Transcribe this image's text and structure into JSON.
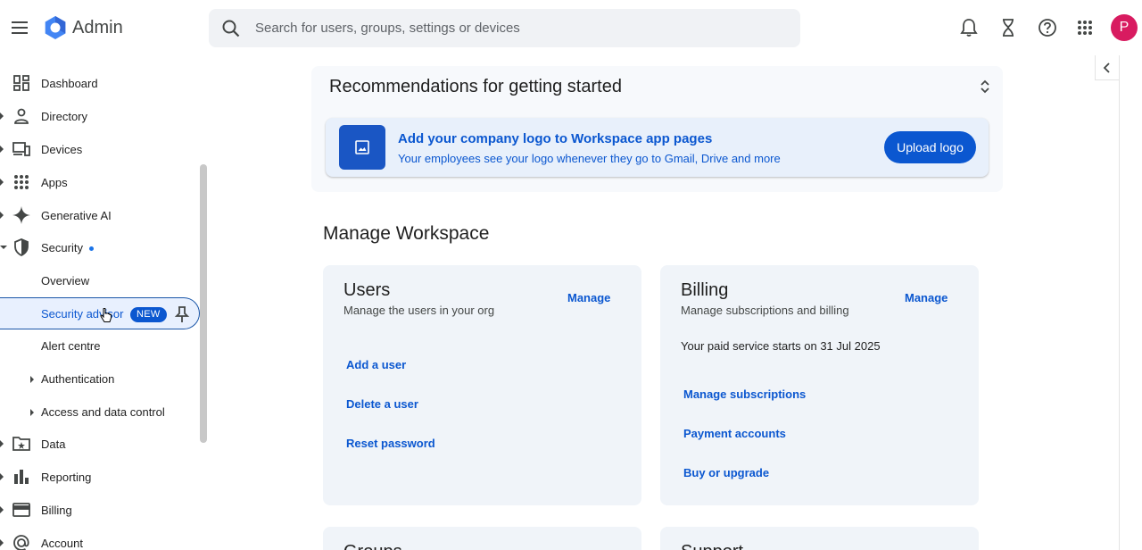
{
  "header": {
    "app_title": "Admin",
    "search_placeholder": "Search for users, groups, settings or devices",
    "avatar_letter": "P"
  },
  "sidebar": {
    "items": [
      {
        "label": "Dashboard"
      },
      {
        "label": "Directory"
      },
      {
        "label": "Devices"
      },
      {
        "label": "Apps"
      },
      {
        "label": "Generative AI"
      },
      {
        "label": "Security"
      },
      {
        "label": "Overview"
      },
      {
        "label": "Security advisor",
        "badge": "NEW"
      },
      {
        "label": "Alert centre"
      },
      {
        "label": "Authentication"
      },
      {
        "label": "Access and data control"
      },
      {
        "label": "Data"
      },
      {
        "label": "Reporting"
      },
      {
        "label": "Billing"
      },
      {
        "label": "Account"
      }
    ]
  },
  "recommendations": {
    "title": "Recommendations for getting started",
    "banner_title": "Add your company logo to Workspace app pages",
    "banner_text": "Your employees see your logo whenever they go to Gmail, Drive and more",
    "button": "Upload logo"
  },
  "manage": {
    "title": "Manage Workspace",
    "users": {
      "title": "Users",
      "subtitle": "Manage the users in your org",
      "manage": "Manage",
      "links": [
        "Add a user",
        "Delete a user",
        "Reset password"
      ]
    },
    "billing": {
      "title": "Billing",
      "subtitle": "Manage subscriptions and billing",
      "manage": "Manage",
      "note": "Your paid service starts on 31 Jul 2025",
      "links": [
        "Manage subscriptions",
        "Payment accounts",
        "Buy or upgrade"
      ]
    },
    "groups": {
      "title": "Groups"
    },
    "support": {
      "title": "Support"
    }
  },
  "colors": {
    "accent": "#0b57d0",
    "avatar": "#d81b60",
    "card_bg": "#f0f4f9"
  }
}
